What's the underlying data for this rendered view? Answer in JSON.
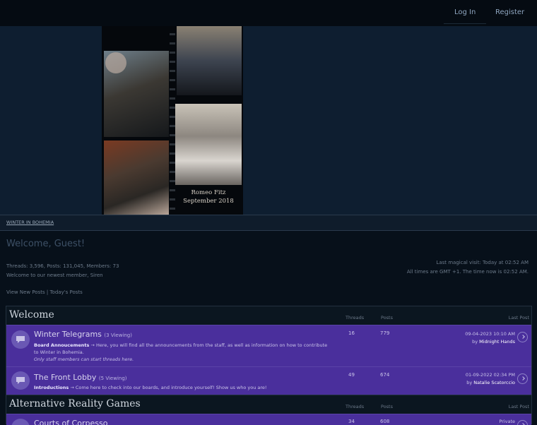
{
  "header": {
    "login_label": "Log In",
    "register_label": "Register"
  },
  "banner": {
    "caption_line1": "Romeo Fitz",
    "caption_line2": "September 2018"
  },
  "breadcrumb": "WINTER IN BOHEMIA",
  "welcome": {
    "greeting": "Welcome, Guest!",
    "stats": "Threads: 3,596, Posts: 131,045, Members: 73",
    "newest_member": "Welcome to our newest member, Siren",
    "last_visit": "Last magical visit: Today at 02:52 AM",
    "timezone": "All times are GMT +1. The time now is 02:52 AM.",
    "link_new_posts": "View New Posts",
    "separator": "|",
    "link_todays_posts": "Today's Posts"
  },
  "categories": [
    {
      "title": "Welcome",
      "col_threads": "Threads",
      "col_posts": "Posts",
      "col_last": "Last Post",
      "forums": [
        {
          "title": "Winter Telegrams",
          "viewing": "(3 Viewing)",
          "sub_label": "Board Annoucements",
          "desc": " → Here, you will find all the announcements from the staff, as well as information on how to contribute to Winter in Bohemia.",
          "note": "Only staff members can start threads here.",
          "threads": "16",
          "posts": "779",
          "last_date": "09-04-2023 10:10 AM",
          "last_by": "by",
          "last_user": "Midnight Hands"
        },
        {
          "title": "The Front Lobby",
          "viewing": "(5 Viewing)",
          "sub_label": "Introductions",
          "desc": " → Come here to check into our boards, and introduce yourself! Show us who you are!",
          "threads": "49",
          "posts": "674",
          "last_date": "01-09-2022 02:34 PM",
          "last_by": "by",
          "last_user": "Natalie Scatorccio"
        }
      ]
    },
    {
      "title": "Alternative Reality Games",
      "col_threads": "Threads",
      "col_posts": "Posts",
      "col_last": "Last Post",
      "forums": [
        {
          "title": "Courts of Corpesso",
          "threads": "34",
          "posts": "608",
          "last_date": "Private"
        }
      ]
    }
  ],
  "colors": {
    "page_bg": "#07101a",
    "banner_bg": "#0e1e30",
    "forum_row": "#4a2f9c",
    "forum_icon": "#6a58b4"
  },
  "icons": [
    "speech-bubble-icon",
    "chevron-right-icon"
  ]
}
